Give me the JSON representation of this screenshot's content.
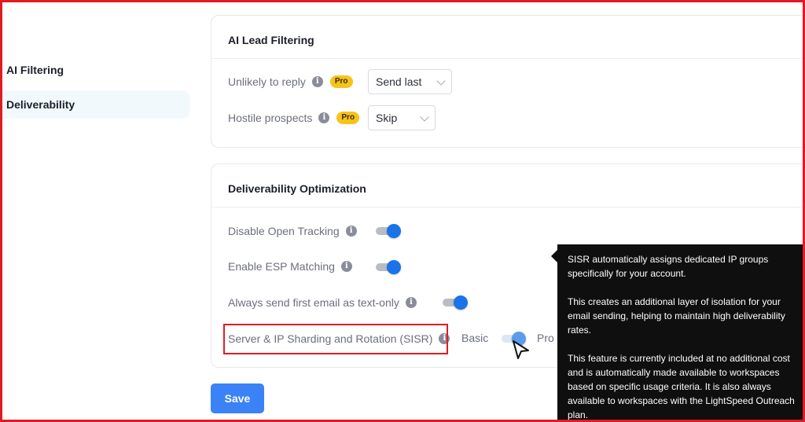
{
  "sidebar": {
    "items": [
      {
        "label": "AI Filtering",
        "active": false
      },
      {
        "label": "Deliverability",
        "active": true
      }
    ]
  },
  "lead_filtering": {
    "title": "AI Lead Filtering",
    "rows": [
      {
        "label": "Unlikely to reply",
        "badge": "Pro",
        "value": "Send last"
      },
      {
        "label": "Hostile prospects",
        "badge": "Pro",
        "value": "Skip"
      }
    ]
  },
  "deliverability": {
    "title": "Deliverability Optimization",
    "toggles": [
      {
        "label": "Disable Open Tracking",
        "on": true
      },
      {
        "label": "Enable ESP Matching",
        "on": true
      },
      {
        "label": "Always send first email as text-only",
        "on": true
      }
    ],
    "sisr": {
      "label": "Server & IP Sharding and Rotation (SISR)",
      "left_option": "Basic",
      "right_option": "Pro"
    }
  },
  "save_label": "Save",
  "tooltip": {
    "paragraphs": [
      "SISR automatically assigns dedicated IP groups specifically for your account.",
      "This creates an additional layer of isolation for your email sending, helping to maintain high deliverability rates.",
      "This feature is currently included at no additional cost and is automatically made available to workspaces based on specific usage criteria. It is also always available to workspaces with the LightSpeed Outreach plan."
    ]
  },
  "colors": {
    "accent": "#1a73e8",
    "save_button": "#3b82f6",
    "pro_badge": "#f7c31b",
    "highlight_border": "#e01b24",
    "tooltip_bg": "#0f0f10"
  },
  "icons": [
    "info-icon",
    "chevron-down-icon",
    "mouse-cursor-icon"
  ]
}
